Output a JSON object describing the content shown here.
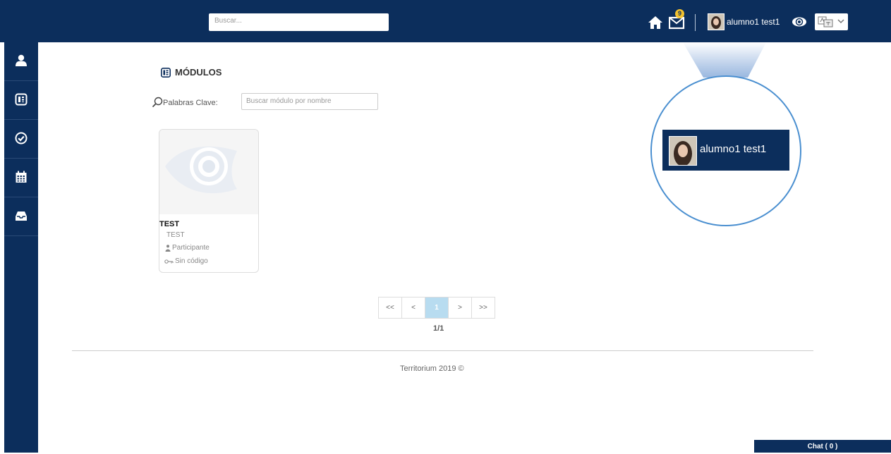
{
  "header": {
    "search_placeholder": "Buscar...",
    "mail_badge": "9",
    "user_name": "alumno1 test1"
  },
  "sidebar": {
    "items": [
      {
        "icon": "user-icon"
      },
      {
        "icon": "module-icon"
      },
      {
        "icon": "check-circle-icon"
      },
      {
        "icon": "calendar-icon"
      },
      {
        "icon": "inbox-icon"
      }
    ]
  },
  "main": {
    "section_title": "MÓDULOS",
    "keywords_label": "Palabras Clave:",
    "keywords_placeholder": "Buscar módulo por nombre",
    "modules": [
      {
        "title": "TEST",
        "subtitle": "TEST",
        "role": "Participante",
        "code": "Sin código"
      }
    ],
    "pagination": {
      "first": "<<",
      "prev": "<",
      "current": "1",
      "next": ">",
      "last": ">>",
      "count": "1/1"
    }
  },
  "footer": {
    "text": "Territorium 2019 ©"
  },
  "chat": {
    "label": "Chat ( 0 )"
  },
  "zoom_callout": {
    "user_name": "alumno1 test1"
  },
  "colors": {
    "navy": "#0c2e5c",
    "accent_blue": "#4a8fd0",
    "active_page": "#b8dcf0",
    "badge": "#f2c12e"
  }
}
